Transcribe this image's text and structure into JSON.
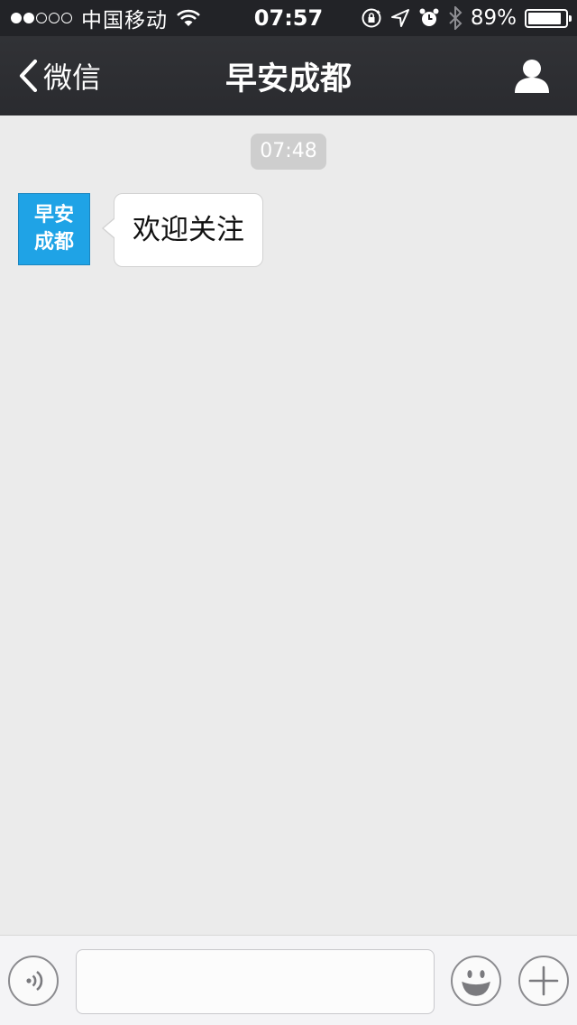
{
  "status_bar": {
    "carrier": "中国移动",
    "signal_bars_filled": 2,
    "signal_bars_total": 5,
    "time": "07:57",
    "battery_percent_label": "89%",
    "battery_level": 0.89,
    "icons": [
      "wifi-icon",
      "rotation-lock-icon",
      "location-arrow-icon",
      "alarm-icon",
      "bluetooth-icon",
      "battery-icon"
    ]
  },
  "nav": {
    "back_label": "微信",
    "title": "早安成都",
    "back_icon": "chevron-left-icon",
    "profile_icon": "person-icon"
  },
  "chat": {
    "timestamp": "07:48",
    "messages": [
      {
        "sender_avatar": {
          "line1": "早安",
          "line2": "成都",
          "color": "#1fa3e6"
        },
        "text": "欢迎关注"
      }
    ]
  },
  "input_bar": {
    "text_value": "",
    "voice_icon": "voice-icon",
    "emoji_icon": "emoji-icon",
    "plus_icon": "plus-icon"
  },
  "colors": {
    "status_bar_bg": "#222327",
    "nav_bg": "#2e2f33",
    "chat_bg": "#ebebeb",
    "avatar_bg": "#1fa3e6",
    "bubble_bg": "#ffffff"
  }
}
